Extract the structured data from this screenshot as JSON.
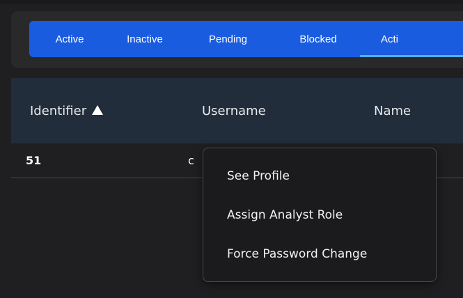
{
  "tabs": [
    {
      "label": "Active"
    },
    {
      "label": "Inactive"
    },
    {
      "label": "Pending"
    },
    {
      "label": "Blocked"
    },
    {
      "label": "Acti"
    }
  ],
  "table": {
    "headers": [
      "Identifier",
      "Username",
      "Name"
    ],
    "sort_icon": "triangle-up-icon",
    "rows": [
      {
        "identifier": "51",
        "username": "c"
      }
    ]
  },
  "context_menu": {
    "items": [
      "See Profile",
      "Assign Analyst Role",
      "Force Password Change"
    ]
  },
  "colors": {
    "tab_bar": "#1a5ce0",
    "selected_underline": "#4fb0ff",
    "header_bg": "#212d3b",
    "page_bg": "#1f1f22"
  }
}
